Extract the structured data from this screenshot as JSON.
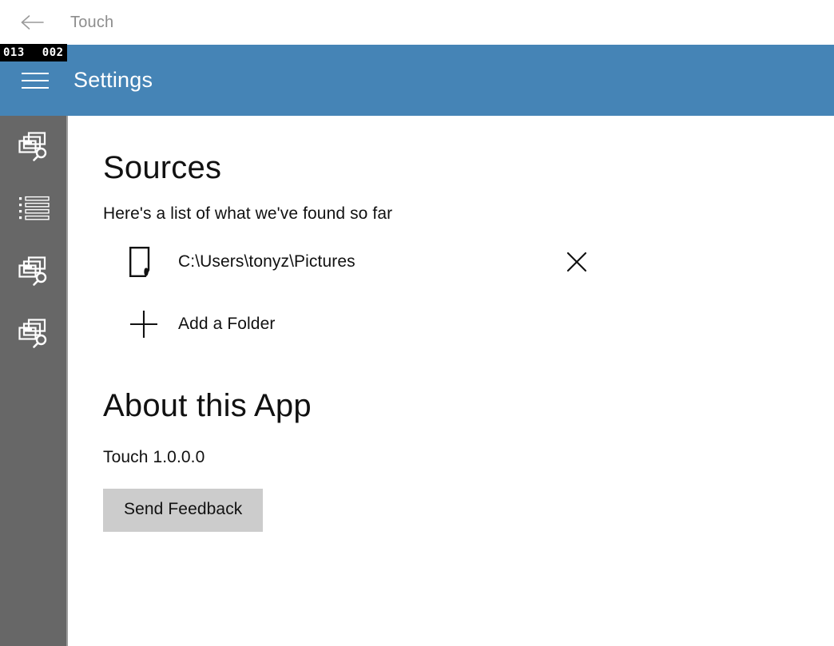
{
  "window": {
    "back_icon": "back-arrow-icon",
    "title": "Touch"
  },
  "command_bar": {
    "menu_icon": "hamburger-menu-icon",
    "title": "Settings",
    "background_color": "#4584b6"
  },
  "overlay_counters": {
    "frame_counter": "013",
    "secondary_counter": "002"
  },
  "sidebar": {
    "background_color": "#676767",
    "items": [
      {
        "name": "sidebar-item-photo-search-1",
        "icon": "photos-search-icon"
      },
      {
        "name": "sidebar-item-list",
        "icon": "bulleted-list-icon"
      },
      {
        "name": "sidebar-item-photo-search-2",
        "icon": "photos-search-icon"
      },
      {
        "name": "sidebar-item-photo-search-3",
        "icon": "photos-search-icon"
      }
    ]
  },
  "main": {
    "sources": {
      "heading": "Sources",
      "subheading": "Here's a list of what we've found so far",
      "rows": [
        {
          "icon": "folder-document-icon",
          "path": "C:\\Users\\tonyz\\Pictures",
          "remove_icon": "close-x-icon"
        }
      ],
      "add_folder": {
        "icon": "plus-icon",
        "label": "Add a Folder"
      }
    },
    "about": {
      "heading": "About this App",
      "version": "Touch 1.0.0.0",
      "feedback_label": "Send Feedback",
      "feedback_bg": "#cccccc"
    }
  }
}
